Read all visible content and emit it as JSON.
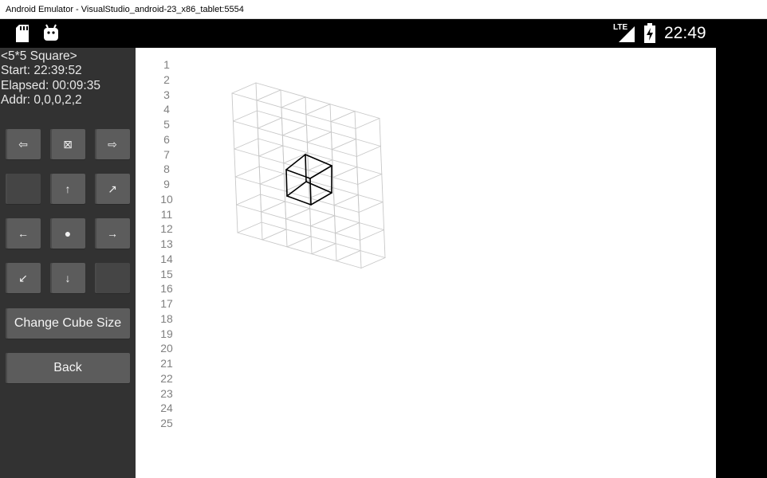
{
  "window": {
    "title": "Android Emulator - VisualStudio_android-23_x86_tablet:5554"
  },
  "statusbar": {
    "time": "22:49",
    "network_label": "LTE",
    "icons": [
      "sd-card-icon",
      "android-debug-icon",
      "signal-lte-icon",
      "battery-charging-icon"
    ]
  },
  "info": {
    "title": "<5*5 Square>",
    "start": "Start: 22:39:52",
    "elapsed": "Elapsed: 00:09:35",
    "addr": "Addr: 0,0,0,2,2"
  },
  "pad": {
    "back_left": "⇦",
    "reset": "⊠",
    "forward_right": "⇨",
    "up": "↑",
    "up_right": "↗",
    "left": "←",
    "center": "●",
    "right": "→",
    "down_left": "↙",
    "down": "↓"
  },
  "buttons": {
    "change_size": "Change Cube Size",
    "back": "Back"
  },
  "line_numbers": [
    "1",
    "2",
    "3",
    "4",
    "5",
    "6",
    "7",
    "8",
    "9",
    "10",
    "11",
    "12",
    "13",
    "14",
    "15",
    "16",
    "17",
    "18",
    "19",
    "20",
    "21",
    "22",
    "23",
    "24",
    "25"
  ],
  "colors": {
    "sidebar_bg": "#323232",
    "button_bg": "#5c5c5c",
    "grid_line": "#c8c8c8",
    "highlight_cube": "#000000",
    "line_number": "#808080"
  }
}
